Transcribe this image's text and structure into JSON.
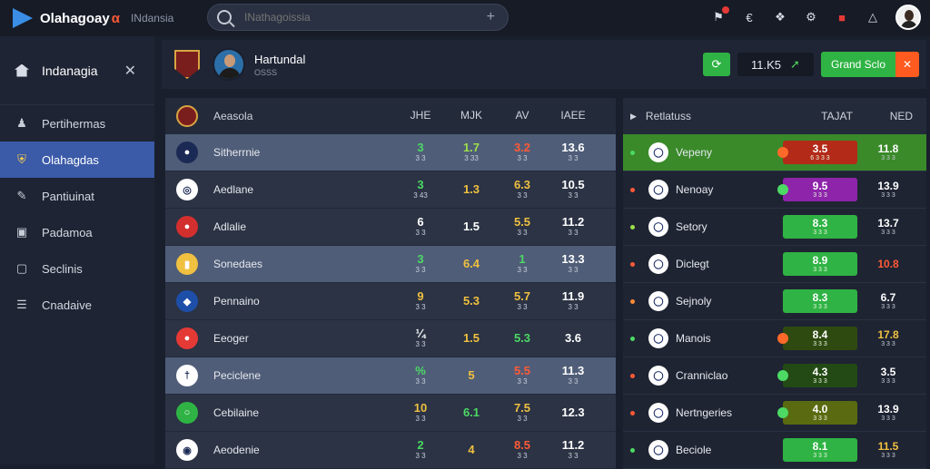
{
  "topbar": {
    "brand": "Olahagoay",
    "brand_accent": "α",
    "region": "INdansia",
    "search_placeholder": "INathagoissia"
  },
  "sidebar": {
    "header_label": "Indanagia",
    "items": [
      {
        "label": "Pertihermas",
        "icon": "person-icon",
        "active": false
      },
      {
        "label": "Olahagdas",
        "icon": "crest-icon",
        "active": true
      },
      {
        "label": "Pantiuinat",
        "icon": "pen-icon",
        "active": false
      },
      {
        "label": "Padamoa",
        "icon": "box-icon",
        "active": false
      },
      {
        "label": "Seclinis",
        "icon": "monitor-icon",
        "active": false
      },
      {
        "label": "Cnadaive",
        "icon": "list-icon",
        "active": false
      }
    ]
  },
  "header": {
    "title": "Hartundal",
    "subtitle": "OSSS",
    "odds_value": "11.K5",
    "cta_label": "Grand Sclo"
  },
  "left_table": {
    "columns": [
      "Aeasola",
      "JHE",
      "MJK",
      "AV",
      "IAEE"
    ],
    "rows": [
      {
        "name": "Sitherrnie",
        "badge_color": "#1b2a55",
        "badge_text": "●",
        "shade": "light",
        "cells": [
          {
            "a": "3",
            "b": "3 3",
            "c": "c-green"
          },
          {
            "a": "1.7",
            "b": "3 33",
            "c": "c-lime"
          },
          {
            "a": "3.2",
            "b": "3 3",
            "c": "c-red"
          },
          {
            "a": "13.6",
            "b": "3 3",
            "c": "c-white"
          }
        ]
      },
      {
        "name": "Aedlane",
        "badge_color": "#ffffff",
        "badge_text": "◎",
        "shade": "dark",
        "cells": [
          {
            "a": "3",
            "b": "3 43",
            "c": "c-green"
          },
          {
            "a": "1.3",
            "b": "",
            "c": "c-yellow"
          },
          {
            "a": "6.3",
            "b": "3 3",
            "c": "c-yellow"
          },
          {
            "a": "10.5",
            "b": "3 3",
            "c": "c-white"
          }
        ]
      },
      {
        "name": "Adlalie",
        "badge_color": "#d32f2f",
        "badge_text": "●",
        "shade": "dark",
        "cells": [
          {
            "a": "6",
            "b": "3 3",
            "c": "c-white"
          },
          {
            "a": "1.5",
            "b": "",
            "c": "c-white"
          },
          {
            "a": "5.5",
            "b": "3 3",
            "c": "c-yellow"
          },
          {
            "a": "11.2",
            "b": "3 3",
            "c": "c-white"
          }
        ]
      },
      {
        "name": "Sonedaes",
        "badge_color": "#f0c040",
        "badge_text": "▮",
        "shade": "light",
        "cells": [
          {
            "a": "3",
            "b": "3 3",
            "c": "c-green"
          },
          {
            "a": "6.4",
            "b": "",
            "c": "c-yellow"
          },
          {
            "a": "1",
            "b": "3 3",
            "c": "c-green"
          },
          {
            "a": "13.3",
            "b": "3 3",
            "c": "c-white"
          }
        ]
      },
      {
        "name": "Pennaino",
        "badge_color": "#1e4fa8",
        "badge_text": "◆",
        "shade": "dark",
        "cells": [
          {
            "a": "9",
            "b": "3 3",
            "c": "c-yellow"
          },
          {
            "a": "5.3",
            "b": "",
            "c": "c-yellow"
          },
          {
            "a": "5.7",
            "b": "3 3",
            "c": "c-yellow"
          },
          {
            "a": "11.9",
            "b": "3 3",
            "c": "c-white"
          }
        ]
      },
      {
        "name": "Eeoger",
        "badge_color": "#e53935",
        "badge_text": "●",
        "shade": "dark",
        "cells": [
          {
            "a": "¼",
            "b": "3 3",
            "c": "c-white"
          },
          {
            "a": "1.5",
            "b": "",
            "c": "c-yellow"
          },
          {
            "a": "5.3",
            "b": "",
            "c": "c-green"
          },
          {
            "a": "3.6",
            "b": "",
            "c": "c-white"
          }
        ]
      },
      {
        "name": "Peciclene",
        "badge_color": "#ffffff",
        "badge_text": "†",
        "shade": "light",
        "cells": [
          {
            "a": "%",
            "b": "3 3",
            "c": "c-green"
          },
          {
            "a": "5",
            "b": "",
            "c": "c-yellow"
          },
          {
            "a": "5.5",
            "b": "3 3",
            "c": "c-red"
          },
          {
            "a": "11.3",
            "b": "3 3",
            "c": "c-white"
          }
        ]
      },
      {
        "name": "Cebilaine",
        "badge_color": "#2fb344",
        "badge_text": "○",
        "shade": "dark",
        "cells": [
          {
            "a": "10",
            "b": "3 3",
            "c": "c-yellow"
          },
          {
            "a": "6.1",
            "b": "",
            "c": "c-green"
          },
          {
            "a": "7.5",
            "b": "3 3",
            "c": "c-yellow"
          },
          {
            "a": "12.3",
            "b": "",
            "c": "c-white"
          }
        ]
      },
      {
        "name": "Aeodenie",
        "badge_color": "#ffffff",
        "badge_text": "◉",
        "shade": "dark",
        "cells": [
          {
            "a": "2",
            "b": "3 3",
            "c": "c-green"
          },
          {
            "a": "4",
            "b": "",
            "c": "c-yellow"
          },
          {
            "a": "8.5",
            "b": "3 3",
            "c": "c-red"
          },
          {
            "a": "11.2",
            "b": "3 3",
            "c": "c-white"
          }
        ]
      }
    ]
  },
  "right_table": {
    "columns": [
      "Retlatuss",
      "TAJAT",
      "NED"
    ],
    "rows": [
      {
        "name": "Vepeny",
        "dot": "#4cd964",
        "highlight": true,
        "bar_color": "#b32a18",
        "chip": "#ff6a2a",
        "a": "3.5",
        "b": "6 3 3 3",
        "r": "11.8",
        "rb": "3 3 3",
        "rc": "c-white"
      },
      {
        "name": "Nenoay",
        "dot": "#ff5a36",
        "highlight": false,
        "bar_color": "#8e24aa",
        "chip": "#4cd964",
        "a": "9.5",
        "b": "3 3 3",
        "r": "13.9",
        "rb": "3 3 3",
        "rc": "c-white"
      },
      {
        "name": "Setory",
        "dot": "#9be04a",
        "highlight": false,
        "bar_color": "#2fb344",
        "chip": "",
        "a": "8.3",
        "b": "3 3 3",
        "r": "13.7",
        "rb": "3 3 3",
        "rc": "c-white"
      },
      {
        "name": "Diclegt",
        "dot": "#ff5a36",
        "highlight": false,
        "bar_color": "#2fb344",
        "chip": "",
        "a": "8.9",
        "b": "3 3 3",
        "r": "10.8",
        "rb": "",
        "rc": "c-red"
      },
      {
        "name": "Sejnoly",
        "dot": "#ff8a36",
        "highlight": false,
        "bar_color": "#2fb344",
        "chip": "",
        "a": "8.3",
        "b": "3 3 3",
        "r": "6.7",
        "rb": "3 3 3",
        "rc": "c-white"
      },
      {
        "name": "Manois",
        "dot": "#4cd964",
        "highlight": false,
        "bar_color": "#2e4a10",
        "chip": "#ff6a2a",
        "a": "8.4",
        "b": "3 3 3",
        "r": "17.8",
        "rb": "3 3 3",
        "rc": "c-yellow"
      },
      {
        "name": "Cranniclao",
        "dot": "#ff5a36",
        "highlight": false,
        "bar_color": "#234a14",
        "chip": "#4cd964",
        "a": "4.3",
        "b": "3 3 3",
        "r": "3.5",
        "rb": "3 3 3",
        "rc": "c-white"
      },
      {
        "name": "Nertngeries",
        "dot": "#ff5a36",
        "highlight": false,
        "bar_color": "#5a6a10",
        "chip": "#4cd964",
        "a": "4.0",
        "b": "3 3 3",
        "r": "13.9",
        "rb": "3 3 3",
        "rc": "c-white"
      },
      {
        "name": "Beciole",
        "dot": "#4cd964",
        "highlight": false,
        "bar_color": "#2fb344",
        "chip": "",
        "a": "8.1",
        "b": "3 3 3",
        "r": "11.5",
        "rb": "3 3 3",
        "rc": "c-yellow"
      }
    ]
  }
}
